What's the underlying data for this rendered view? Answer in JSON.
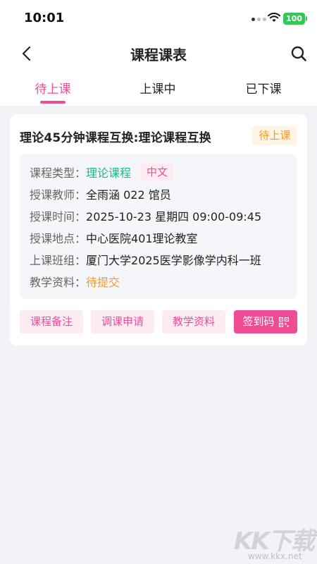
{
  "status_bar": {
    "time": "10:01",
    "battery": "100"
  },
  "nav": {
    "title": "课程课表"
  },
  "tabs": [
    {
      "label": "待上课",
      "active": true
    },
    {
      "label": "上课中",
      "active": false
    },
    {
      "label": "已下课",
      "active": false
    }
  ],
  "card": {
    "title": "理论45分钟课程互换:理论课程互换",
    "status": "待上课",
    "info": {
      "type_label": "课程类型：",
      "type_value": "理论课程",
      "language_tag": "中文",
      "teacher_label": "授课教师：",
      "teacher_value": "全雨涵 022 馆员",
      "time_label": "授课时间：",
      "time_value": "2025-10-23 星期四 09:00-09:45",
      "location_label": "授课地点：",
      "location_value": "中心医院401理论教室",
      "class_label": "上课班组：",
      "class_value": "厦门大学2025医学影像学内科一班",
      "material_label": "教学资料：",
      "material_value": "待提交"
    },
    "actions": {
      "notes": "课程备注",
      "reschedule": "调课申请",
      "materials": "教学资料",
      "checkin": "签到码"
    }
  },
  "watermark": {
    "logo": "KK下载",
    "url": "www.kkx.net"
  },
  "colors": {
    "accent": "#ee4d96",
    "green": "#1cb98a",
    "orange": "#f39a2a"
  }
}
